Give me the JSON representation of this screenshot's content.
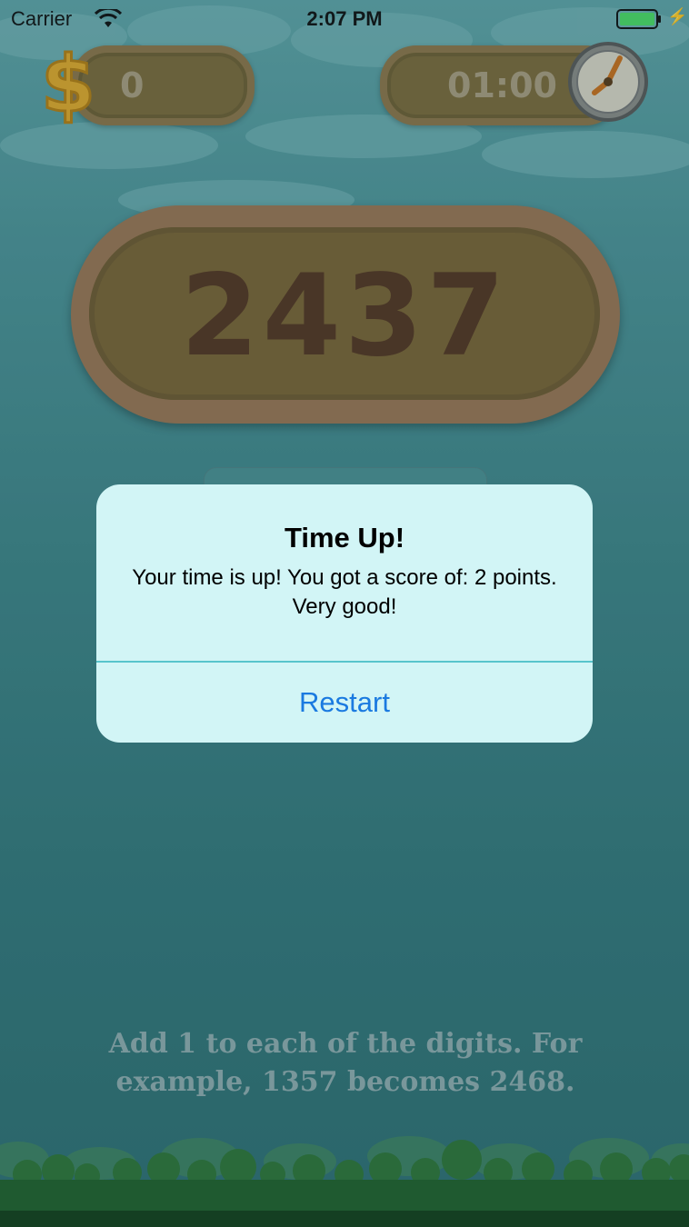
{
  "status_bar": {
    "carrier": "Carrier",
    "time": "2:07 PM",
    "wifi_icon": "wifi-icon",
    "battery_icon": "battery-icon",
    "battery_color": "#4cd964"
  },
  "hud": {
    "coins": "0",
    "coin_icon": "dollar-icon",
    "timer": "01:00",
    "timer_icon": "clock-icon"
  },
  "game": {
    "number": "2437"
  },
  "alert": {
    "title": "Time Up!",
    "message": "Your time is up! You got a score of: 2 points. Very good!",
    "button": "Restart",
    "button_color": "#1a7ae0"
  },
  "instructions": "Add 1 to each of the digits. For example, 1357 becomes 2468."
}
